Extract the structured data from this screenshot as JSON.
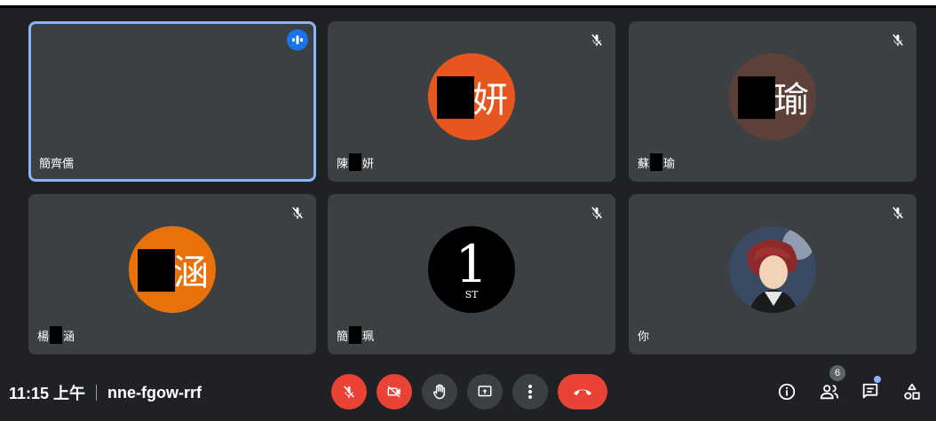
{
  "participants": [
    {
      "name": "簡齊儒",
      "speaking": true
    },
    {
      "name_prefix": "陳",
      "name_suffix": "妍",
      "avatar_glyph": "妍",
      "avatar_color": "#e8561f",
      "muted": true
    },
    {
      "name_prefix": "蘇",
      "name_suffix": "瑜",
      "avatar_glyph": "瑜",
      "avatar_color": "#5d4037",
      "muted": true
    },
    {
      "name_prefix": "楊",
      "name_suffix": "涵",
      "avatar_glyph": "涵",
      "avatar_color": "#e8710a",
      "muted": true
    },
    {
      "name_prefix": "簡",
      "name_suffix": "珮",
      "avatar_text_big": "1",
      "avatar_text_small": "ST",
      "muted": true
    },
    {
      "name": "你",
      "muted": true
    }
  ],
  "meeting": {
    "time": "11:15 上午",
    "code": "nne-fgow-rrf",
    "people_count": "6"
  },
  "controls": {
    "mic": "mic-off-icon",
    "camera": "videocam-off-icon",
    "raise_hand": "hand-icon",
    "present": "present-icon",
    "more": "more-vert-icon",
    "leave": "call-end-icon"
  },
  "colors": {
    "accent": "#8ab4f8",
    "danger": "#ea4335",
    "tile": "#3c4043",
    "background": "#202124"
  }
}
